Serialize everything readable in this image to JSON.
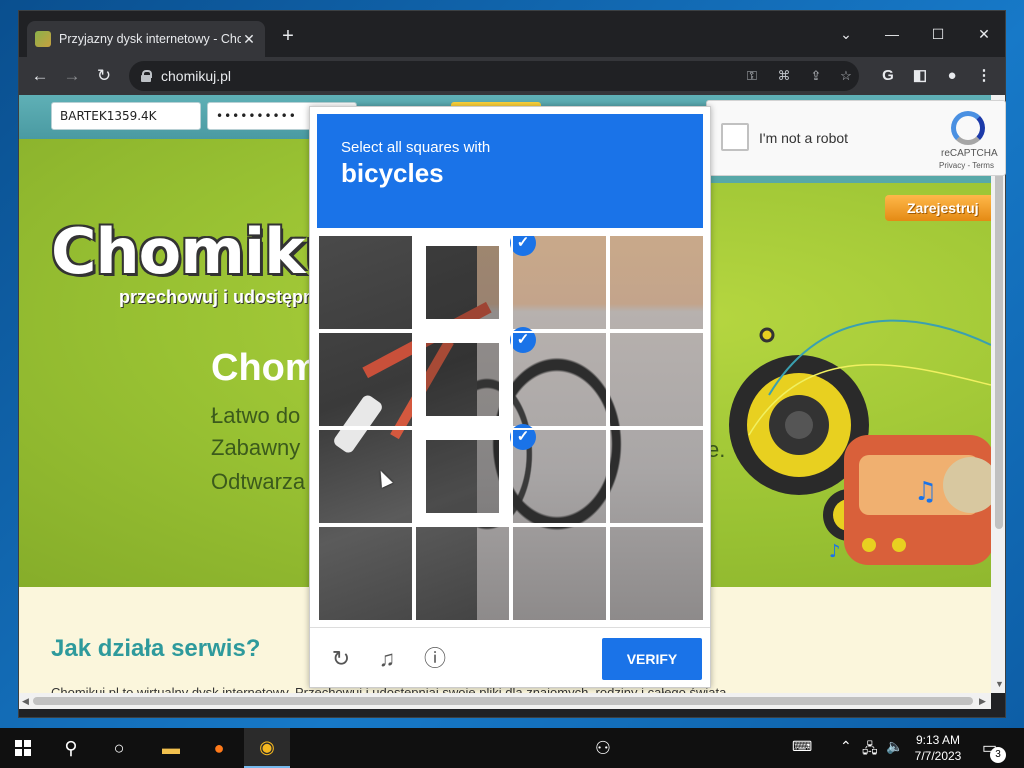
{
  "browser": {
    "tab_title": "Przyjazny dysk internetowy - Chomikuj.pl",
    "url": "chomikuj.pl"
  },
  "site": {
    "username_value": "BARTEK1359.4K",
    "password_value": "••••••••••",
    "logo_text": "Chomikuj.",
    "tagline": "przechowuj i udostępni",
    "hero_heading": "Chom",
    "hero_lines": [
      "Łatwo do",
      "Zabawny",
      "Odtwarza"
    ],
    "hero_line_tail": "e.",
    "register_label": "Zarejestruj",
    "how_heading": "Jak działa serwis?",
    "body_text": "Chomikuj.pl to wirtualny dysk internetowy. Przechowuj i udostępniaj swoje pliki dla znajomych, rodziny i całego świata."
  },
  "recaptcha": {
    "checkbox_label": "I'm not a robot",
    "brand": "reCAPTCHA",
    "privacy": "Privacy - Terms"
  },
  "challenge": {
    "instruction": "Select all squares with",
    "object": "bicycles",
    "verify_label": "VERIFY",
    "selected_tiles": [
      1,
      5,
      9
    ]
  },
  "taskbar": {
    "time": "9:13 AM",
    "date": "7/7/2023",
    "notification_count": "3"
  },
  "colors": {
    "challenge_blue": "#1a73e8",
    "site_green": "#99c233",
    "site_teal": "#2e9a9c"
  }
}
